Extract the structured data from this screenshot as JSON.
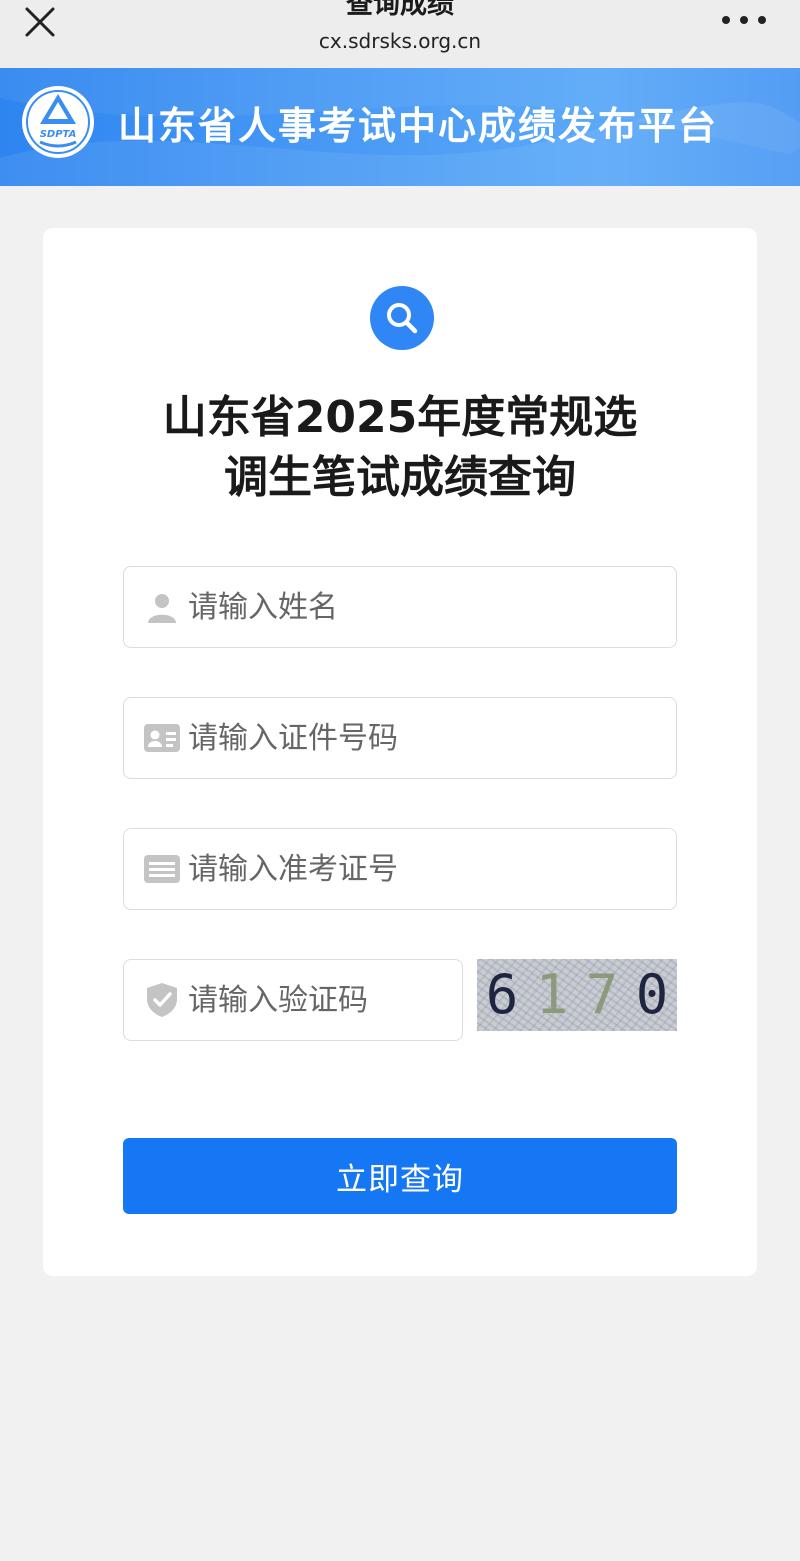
{
  "browser": {
    "title": "查询成绩",
    "url": "cx.sdrsks.org.cn",
    "close_icon": "close-icon",
    "more_icon": "more-dots-icon"
  },
  "banner": {
    "logo_text": "SDPTA",
    "site_name": "山东省人事考试中心成绩发布平台"
  },
  "form": {
    "title_line1": "山东省2025年度常规选",
    "title_line2": "调生笔试成绩查询",
    "fields": {
      "name": {
        "placeholder": "请输入姓名",
        "value": "",
        "icon": "person-icon"
      },
      "id_number": {
        "placeholder": "请输入证件号码",
        "value": "",
        "icon": "id-card-icon"
      },
      "admission_number": {
        "placeholder": "请输入准考证号",
        "value": "",
        "icon": "ticket-icon"
      },
      "captcha": {
        "placeholder": "请输入验证码",
        "value": "",
        "icon": "shield-icon"
      }
    },
    "captcha_image": {
      "d1": "6",
      "d2": "1",
      "d3": "7",
      "d4": "0"
    },
    "submit_label": "立即查询"
  },
  "colors": {
    "primary": "#1677f5",
    "banner": "#4a9bf5",
    "background": "#f1f1f1"
  }
}
